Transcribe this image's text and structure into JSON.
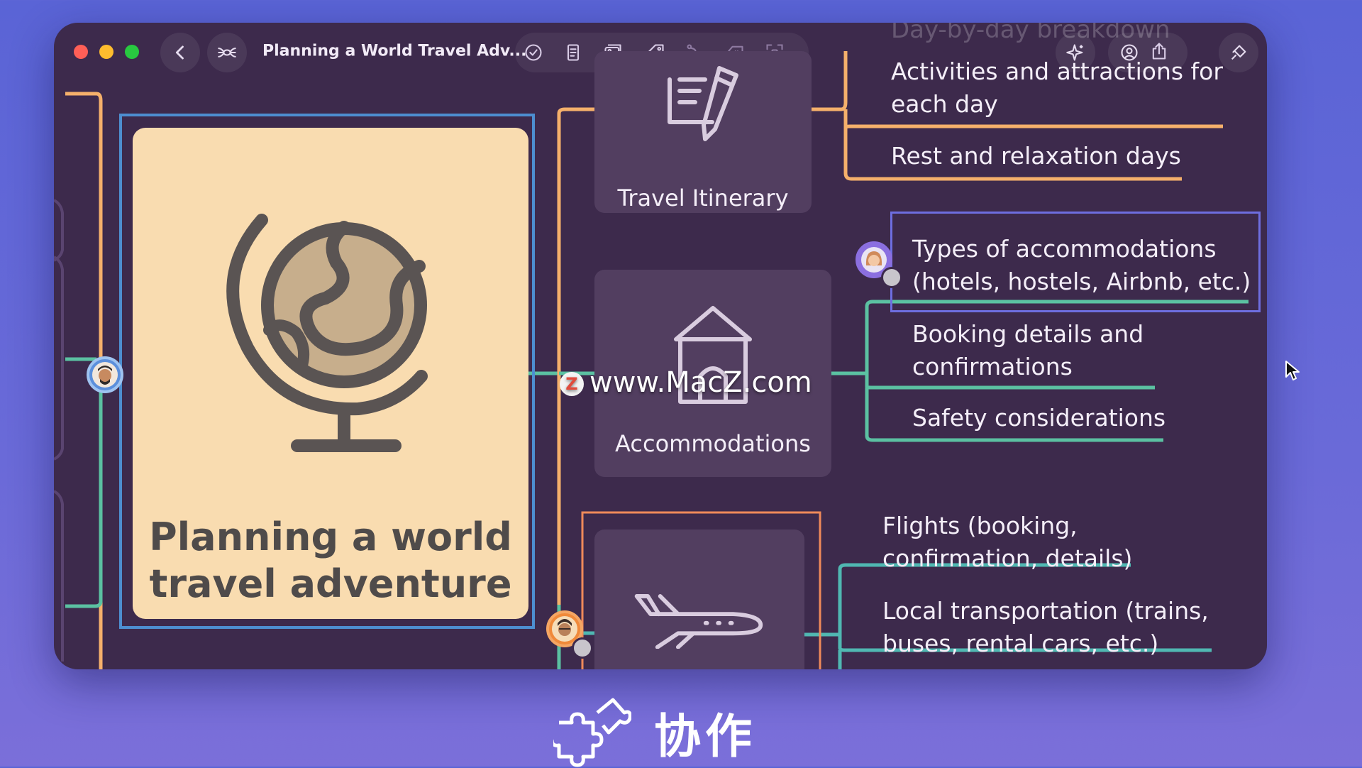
{
  "window": {
    "title": "Planning a World Travel Adv...",
    "traffic_lights": {
      "close": "#ff5f57",
      "minimize": "#febc2e",
      "zoom": "#28c840"
    }
  },
  "toolbar": {
    "left": [
      {
        "name": "back-button",
        "icon": "chevron-left-icon"
      },
      {
        "name": "outline-button",
        "icon": "mindmap-structure-icon"
      }
    ],
    "tools": [
      {
        "name": "task-button",
        "icon": "checkmark-circle-icon"
      },
      {
        "name": "note-button",
        "icon": "note-icon"
      },
      {
        "name": "image-button",
        "icon": "image-icon"
      },
      {
        "name": "label-button",
        "icon": "tag-icon"
      },
      {
        "name": "relationship-button",
        "icon": "relationship-icon"
      },
      {
        "name": "boundary-button",
        "icon": "boundary-icon"
      },
      {
        "name": "focus-button",
        "icon": "focus-icon"
      }
    ],
    "right": [
      {
        "name": "ai-button",
        "icon": "sparkle-icon"
      },
      {
        "name": "collaborate-button",
        "icon": "people-icon"
      },
      {
        "name": "share-button",
        "icon": "share-icon"
      },
      {
        "name": "format-button",
        "icon": "paintbrush-icon"
      }
    ]
  },
  "mindmap": {
    "central_topic": "Planning a world travel adventure",
    "faded_text": "Day-by-day breakdown",
    "topics": [
      {
        "label": "Travel Itinerary",
        "icon": "document-pen-icon",
        "color": "#f5b06b",
        "subtopics": [
          "Activities and attractions for each day",
          "Rest and relaxation days"
        ]
      },
      {
        "label": "Accommodations",
        "icon": "house-icon",
        "color": "#5bc1a2",
        "subtopics": [
          "Types of accommodations (hotels, hostels, Airbnb, etc.)",
          "Booking details and confirmations",
          "Safety considerations"
        ]
      },
      {
        "label": "",
        "icon": "airplane-icon",
        "color": "#50b8b2",
        "subtopics": [
          "Flights (booking, confirmation, details)",
          "Local transportation (trains, buses, rental cars, etc.)"
        ]
      }
    ],
    "collaborator_colors": {
      "blue": "#5b8fdc",
      "purple": "#8b6fe0",
      "orange": "#f08a3a"
    }
  },
  "watermark": {
    "logo": "Z",
    "text": "www.MacZ.com"
  },
  "caption": {
    "text": "协作",
    "icon": "puzzle-icon"
  }
}
